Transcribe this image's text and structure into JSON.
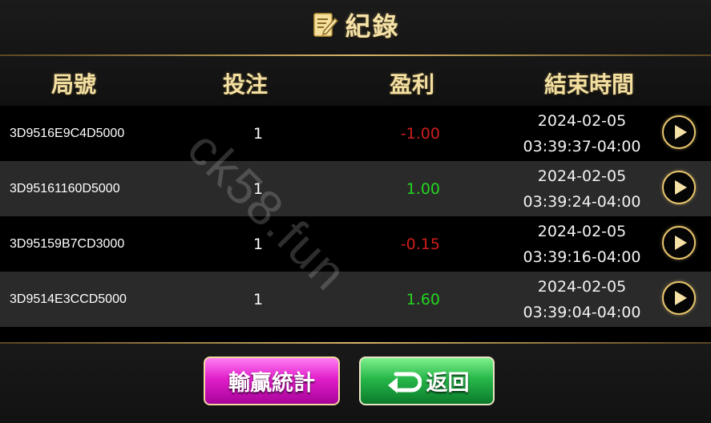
{
  "title": "紀錄",
  "columns": {
    "id": "局號",
    "bet": "投注",
    "profit": "盈利",
    "end_time": "結束時間"
  },
  "rows": [
    {
      "id": "3D9516E9C4D5000",
      "bet": "1",
      "profit": "-1.00",
      "profit_sign": "neg",
      "date": "2024-02-05",
      "time": "03:39:37-04:00"
    },
    {
      "id": "3D95161160D5000",
      "bet": "1",
      "profit": "1.00",
      "profit_sign": "pos",
      "date": "2024-02-05",
      "time": "03:39:24-04:00"
    },
    {
      "id": "3D95159B7CD3000",
      "bet": "1",
      "profit": "-0.15",
      "profit_sign": "neg",
      "date": "2024-02-05",
      "time": "03:39:16-04:00"
    },
    {
      "id": "3D9514E3CCD5000",
      "bet": "1",
      "profit": "1.60",
      "profit_sign": "pos",
      "date": "2024-02-05",
      "time": "03:39:04-04:00"
    }
  ],
  "buttons": {
    "stats": "輸贏統計",
    "back": "返回"
  },
  "watermark": "ck58.fun",
  "colors": {
    "gold": "#f3dfa0",
    "negative": "#cf1d1d",
    "positive": "#23d61e",
    "stats_button": "#e11fca",
    "back_button": "#27b84a"
  },
  "icons": {
    "title": "notepad-pencil-icon",
    "replay": "play-icon",
    "back": "return-arrow-icon"
  }
}
